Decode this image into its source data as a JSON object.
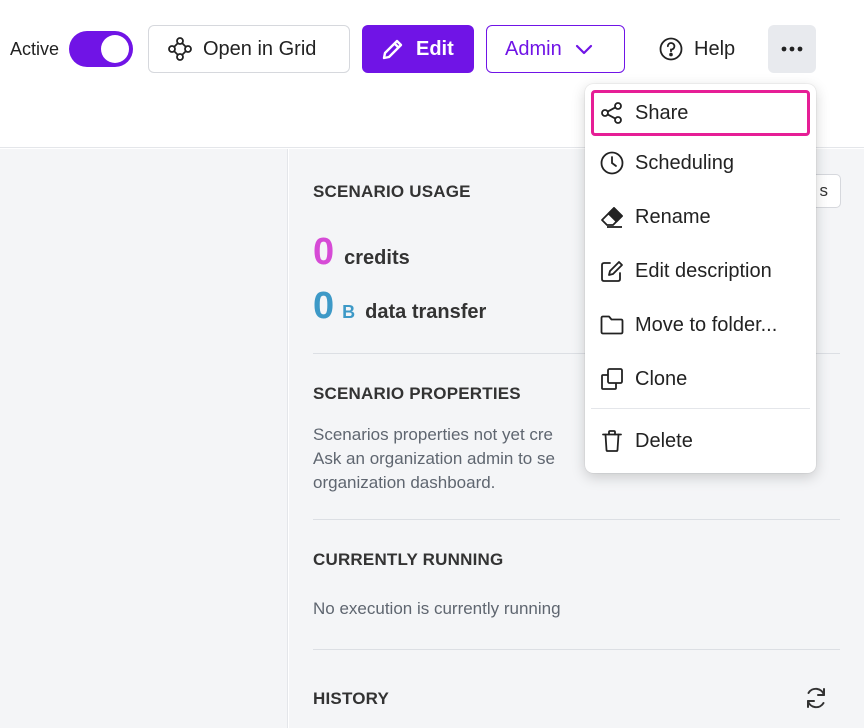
{
  "toolbar": {
    "active_label": "Active",
    "active_on": true,
    "open_grid_label": "Open in Grid",
    "edit_label": "Edit",
    "admin_label": "Admin",
    "help_label": "Help"
  },
  "usage": {
    "title": "SCENARIO USAGE",
    "credits_value": "0",
    "credits_label": "credits",
    "data_value": "0",
    "data_unit": "B",
    "data_label": "data transfer",
    "partial_button_text": "s"
  },
  "properties": {
    "title": "SCENARIO PROPERTIES",
    "line1": "Scenarios properties not yet cre",
    "line2": "Ask an organization admin to se",
    "line3": "organization dashboard."
  },
  "running": {
    "title": "CURRENTLY RUNNING",
    "text": "No execution is currently running"
  },
  "history": {
    "title": "HISTORY"
  },
  "menu": {
    "items": [
      {
        "label": "Share",
        "icon": "share-icon"
      },
      {
        "label": "Scheduling",
        "icon": "clock-icon"
      },
      {
        "label": "Rename",
        "icon": "eraser-icon"
      },
      {
        "label": "Edit description",
        "icon": "edit-icon"
      },
      {
        "label": "Move to folder...",
        "icon": "folder-icon"
      },
      {
        "label": "Clone",
        "icon": "clone-icon"
      },
      {
        "label": "Delete",
        "icon": "trash-icon"
      }
    ]
  },
  "colors": {
    "accent": "#7014e6",
    "highlight": "#e61e96",
    "credits": "#d64bd6",
    "data": "#3d99c7"
  }
}
